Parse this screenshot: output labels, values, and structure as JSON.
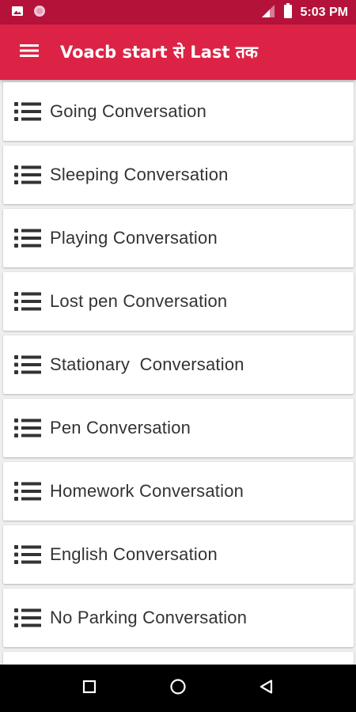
{
  "status_bar": {
    "time": "5:03 PM",
    "background": "#b5123a",
    "left_icons": [
      "image-icon",
      "circle-icon"
    ],
    "right_icons": [
      "signal-icon",
      "battery-icon"
    ]
  },
  "app_bar": {
    "title": "Voacb start से Last तक",
    "background": "#dc2346",
    "menu_icon": "hamburger-menu-icon"
  },
  "list": {
    "item_icon": "list-icon",
    "items": [
      {
        "label": "Going Conversation"
      },
      {
        "label": "Sleeping Conversation"
      },
      {
        "label": "Playing Conversation"
      },
      {
        "label": "Lost pen Conversation"
      },
      {
        "label": "Stationary  Conversation"
      },
      {
        "label": "Pen Conversation"
      },
      {
        "label": "Homework Conversation"
      },
      {
        "label": "English Conversation"
      },
      {
        "label": "No Parking Conversation"
      },
      {
        "label": ""
      }
    ]
  },
  "nav_bar": {
    "buttons": [
      "recents-square-icon",
      "home-circle-icon",
      "back-triangle-icon"
    ]
  }
}
